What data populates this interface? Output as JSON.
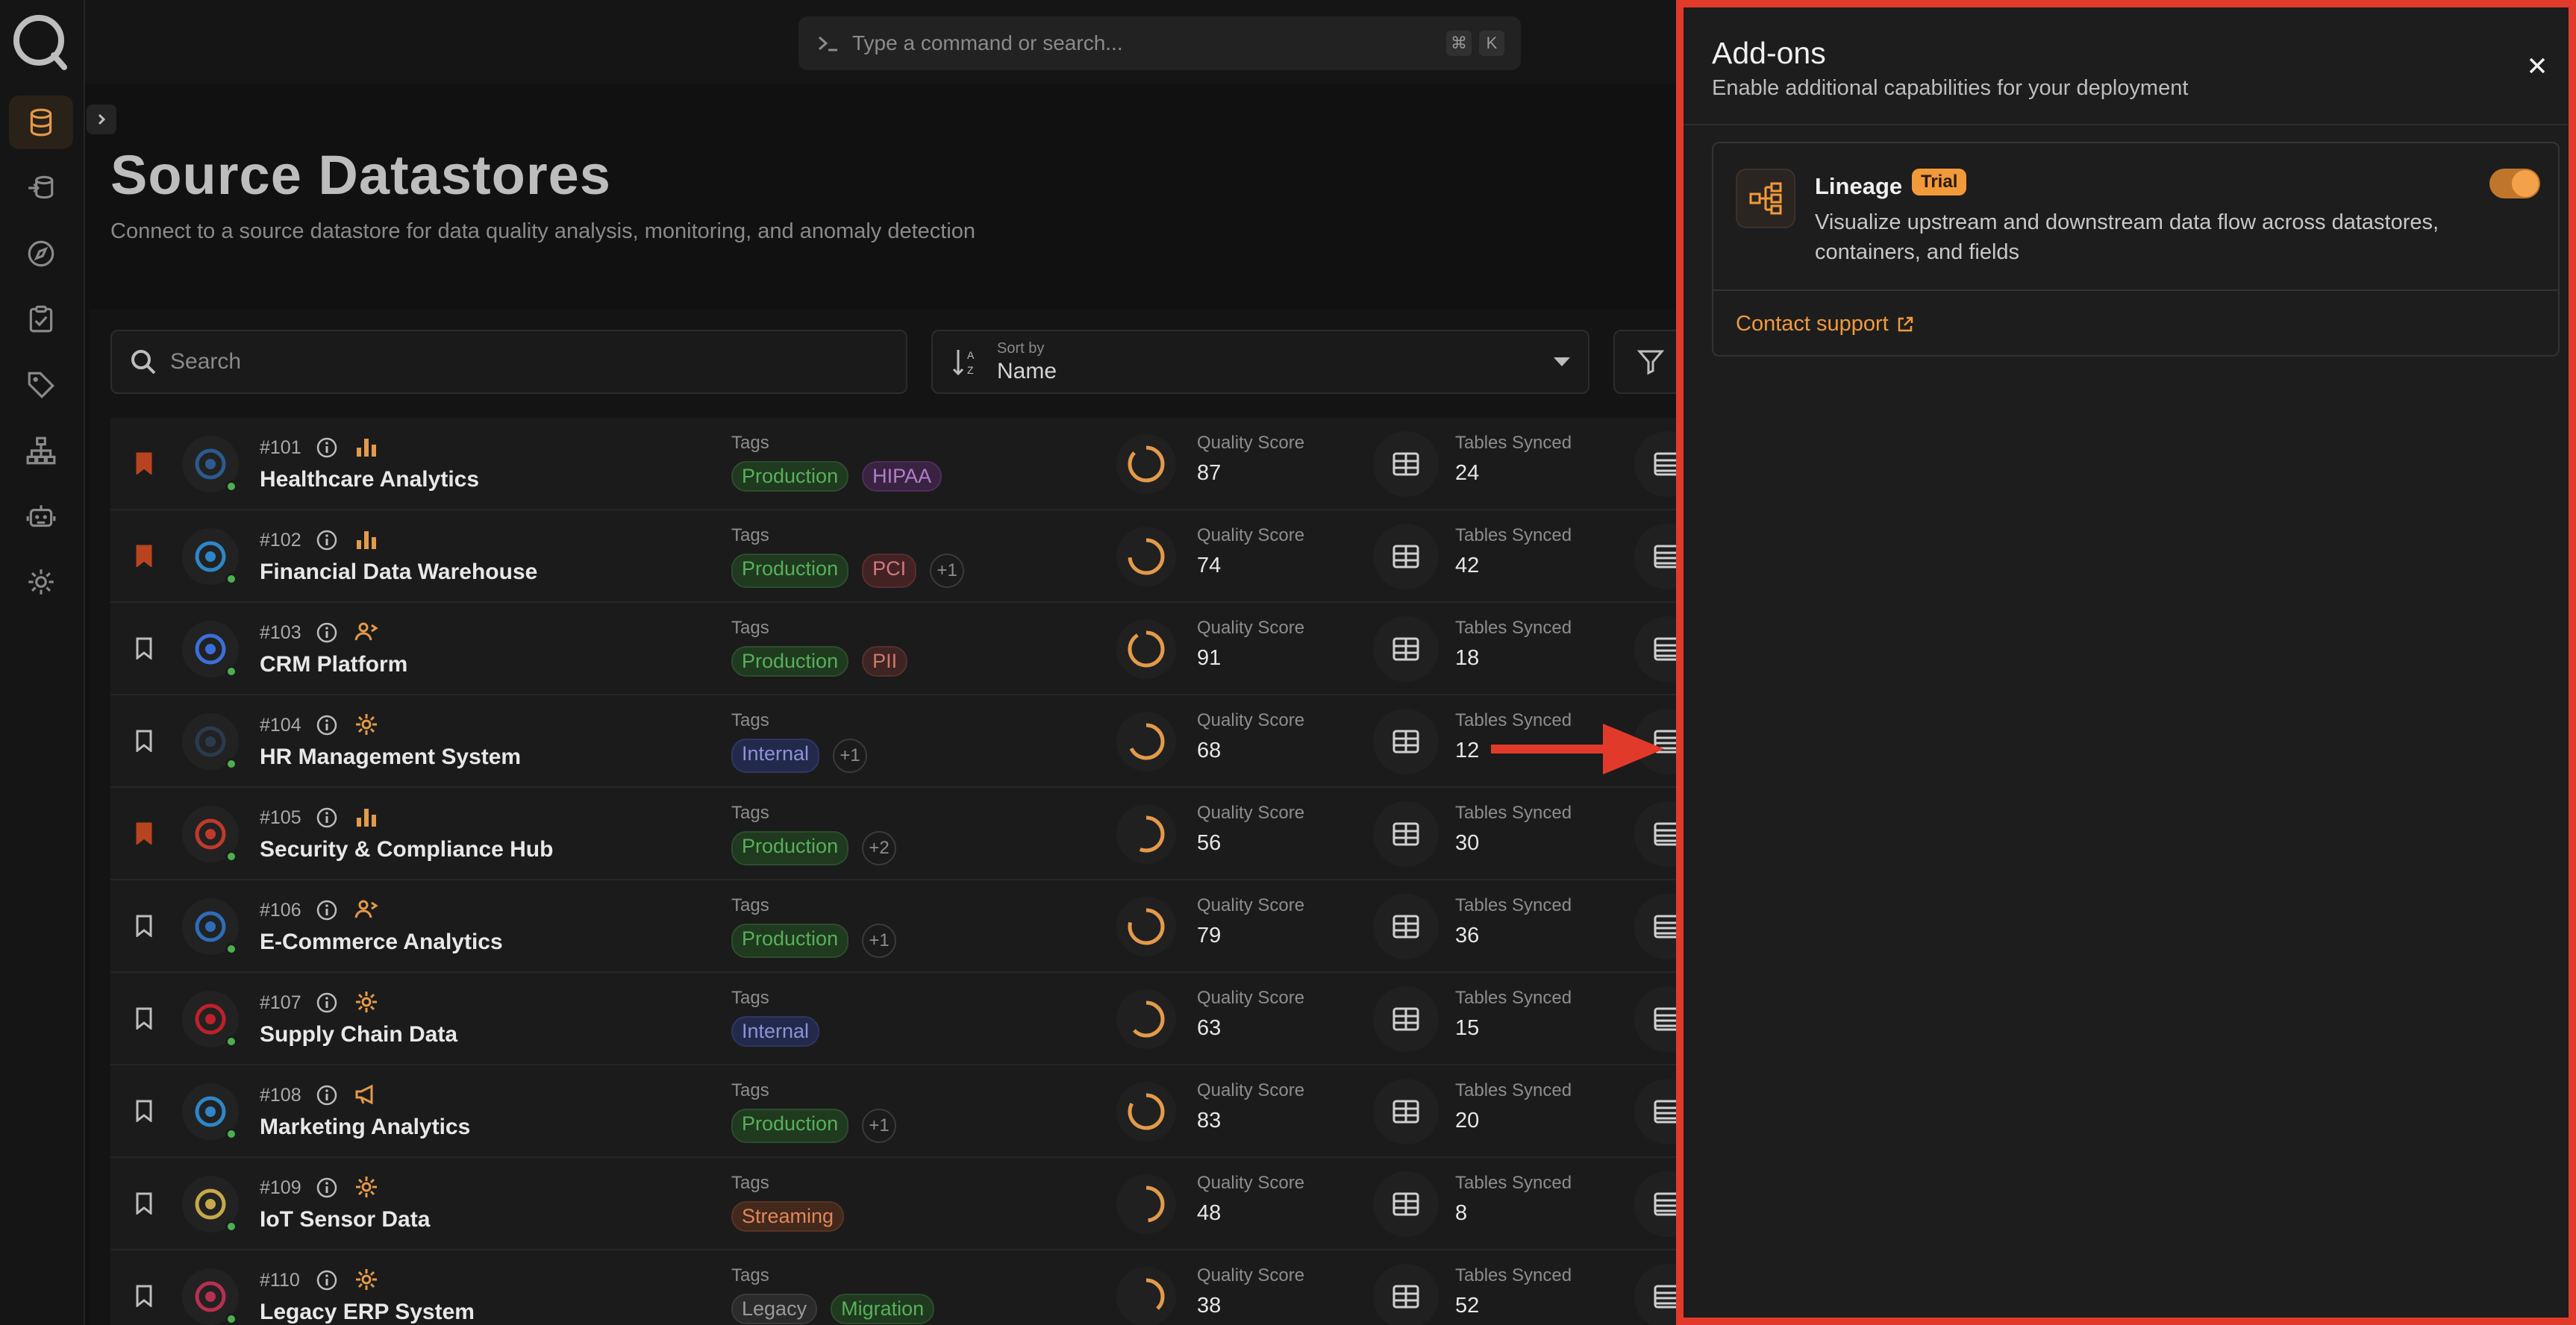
{
  "command_bar": {
    "placeholder": "Type a command or search...",
    "key1": "⌘",
    "key2": "K"
  },
  "page": {
    "title": "Source Datastores",
    "subtitle": "Connect to a source datastore for data quality analysis, monitoring, and anomaly detection"
  },
  "toolbar": {
    "search_placeholder": "Search",
    "sort_label": "Sort by",
    "sort_value": "Name"
  },
  "columns": {
    "tags": "Tags",
    "quality": "Quality Score",
    "tables": "Tables Synced"
  },
  "rows": [
    {
      "id": "#101",
      "name": "Healthcare Analytics",
      "bookmarked": true,
      "type_icon": "bar-chart-icon",
      "tags": [
        {
          "label": "Production",
          "kind": "production"
        },
        {
          "label": "HIPAA",
          "kind": "hipaa"
        }
      ],
      "quality": "87",
      "tables": "24"
    },
    {
      "id": "#102",
      "name": "Financial Data Warehouse",
      "bookmarked": true,
      "type_icon": "bar-chart-icon",
      "tags": [
        {
          "label": "Production",
          "kind": "production"
        },
        {
          "label": "PCI",
          "kind": "pci"
        },
        {
          "label": "+1",
          "kind": "more"
        }
      ],
      "quality": "74",
      "tables": "42"
    },
    {
      "id": "#103",
      "name": "CRM Platform",
      "bookmarked": false,
      "type_icon": "user-share-icon",
      "tags": [
        {
          "label": "Production",
          "kind": "production"
        },
        {
          "label": "PII",
          "kind": "pii"
        }
      ],
      "quality": "91",
      "tables": "18"
    },
    {
      "id": "#104",
      "name": "HR Management System",
      "bookmarked": false,
      "type_icon": "gear-icon",
      "tags": [
        {
          "label": "Internal",
          "kind": "internal"
        },
        {
          "label": "+1",
          "kind": "more"
        }
      ],
      "quality": "68",
      "tables": "12"
    },
    {
      "id": "#105",
      "name": "Security & Compliance Hub",
      "bookmarked": true,
      "type_icon": "bar-chart-icon",
      "tags": [
        {
          "label": "Production",
          "kind": "production"
        },
        {
          "label": "+2",
          "kind": "more"
        }
      ],
      "quality": "56",
      "tables": "30"
    },
    {
      "id": "#106",
      "name": "E-Commerce Analytics",
      "bookmarked": false,
      "type_icon": "user-share-icon",
      "tags": [
        {
          "label": "Production",
          "kind": "production"
        },
        {
          "label": "+1",
          "kind": "more"
        }
      ],
      "quality": "79",
      "tables": "36"
    },
    {
      "id": "#107",
      "name": "Supply Chain Data",
      "bookmarked": false,
      "type_icon": "gear-icon",
      "tags": [
        {
          "label": "Internal",
          "kind": "internal"
        }
      ],
      "quality": "63",
      "tables": "15"
    },
    {
      "id": "#108",
      "name": "Marketing Analytics",
      "bookmarked": false,
      "type_icon": "megaphone-icon",
      "tags": [
        {
          "label": "Production",
          "kind": "production"
        },
        {
          "label": "+1",
          "kind": "more"
        }
      ],
      "quality": "83",
      "tables": "20"
    },
    {
      "id": "#109",
      "name": "IoT Sensor Data",
      "bookmarked": false,
      "type_icon": "gear-icon",
      "tags": [
        {
          "label": "Streaming",
          "kind": "streaming"
        }
      ],
      "quality": "48",
      "tables": "8"
    },
    {
      "id": "#110",
      "name": "Legacy ERP System",
      "bookmarked": false,
      "type_icon": "gear-icon",
      "tags": [
        {
          "label": "Legacy",
          "kind": "legacy"
        },
        {
          "label": "Migration",
          "kind": "migration"
        }
      ],
      "quality": "38",
      "tables": "52"
    }
  ],
  "drawer": {
    "title": "Add-ons",
    "subtitle": "Enable additional capabilities for your deployment",
    "addon": {
      "name": "Lineage",
      "badge": "Trial",
      "description": "Visualize upstream and downstream data flow across datastores, containers, and fields",
      "enabled": true,
      "link": "Contact support"
    }
  },
  "colors": {
    "accent": "#f29a3a",
    "highlight": "#e23a2a",
    "bookmark": "#b8441f"
  }
}
